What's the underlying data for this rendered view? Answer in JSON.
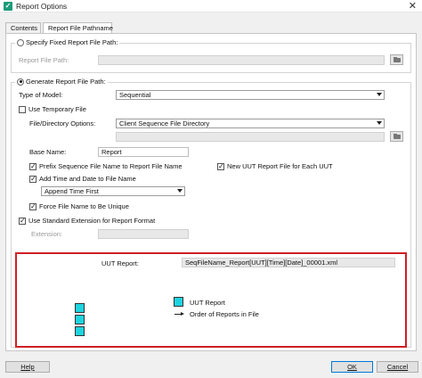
{
  "window": {
    "title": "Report Options",
    "app_icon": "check-icon",
    "close_glyph": "✕"
  },
  "tabs": [
    {
      "label": "Contents"
    },
    {
      "label": "Report File Pathname",
      "selected": true
    }
  ],
  "fixed_group": {
    "radio_label": "Specify Fixed Report File Path:",
    "selected": false,
    "path_label": "Report File Path:",
    "path_value": ""
  },
  "generate_group": {
    "radio_label": "Generate Report File Path:",
    "selected": true,
    "type_of_model_label": "Type of Model:",
    "type_of_model_value": "Sequential",
    "use_temp_dir_label": "Use Temporary File",
    "use_temp_dir_checked": false,
    "file_dir_options_label": "File/Directory Options:",
    "file_dir_options_value": "Client Sequence File Directory",
    "directory_value": "",
    "base_name_label": "Base Name:",
    "base_name_value": "Report",
    "prefix_label": "Prefix Sequence File Name to Report File Name",
    "prefix_checked": true,
    "new_uut_label": "New UUT Report File for Each UUT",
    "new_uut_checked": true,
    "add_time_label": "Add Time and Date to File Name",
    "add_time_checked": true,
    "time_option_value": "Append Time First",
    "force_unique_label": "Force File Name to Be Unique",
    "force_unique_checked": true,
    "std_ext_label": "Use Standard Extension for Report Format",
    "std_ext_checked": true,
    "extension_label": "Extension:",
    "extension_value": ""
  },
  "preview": {
    "uut_report_label": "UUT Report:",
    "uut_report_value": "SeqFileName_Report[UUT][Time][Date]_00001.xml",
    "legend_square_label": "UUT Report",
    "legend_arrow_label": "Order of Reports in File",
    "square_color": "#1fd4e0",
    "highlight_color": "#d01f26"
  },
  "buttons": {
    "help": "Help",
    "ok": "OK",
    "cancel": "Cancel"
  }
}
